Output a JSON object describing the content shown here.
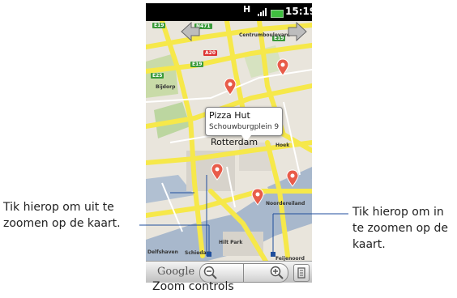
{
  "status_bar": {
    "network": "H",
    "time": "15:19"
  },
  "map": {
    "labels": [
      "Centrumboulevard",
      "Bijdorp",
      "Rotterdam",
      "Noordereiland",
      "Feijenoord",
      "Hoek",
      "Hilt Park",
      "Delfshaven",
      "Schiedam"
    ],
    "shields": [
      "N471",
      "E19",
      "E19",
      "A20",
      "E25",
      "E19"
    ]
  },
  "callout": {
    "title": "Pizza Hut",
    "address": "Schouwburgplein 9"
  },
  "city_label": "Rotterdam",
  "zoom_controls": {
    "logo": "Google",
    "zoom_out_icon": "zoom-out-icon",
    "zoom_in_icon": "zoom-in-icon",
    "menu_icon": "menu-icon"
  },
  "annotations": {
    "left_line1": "Tik hierop om uit te",
    "left_line2": "zoomen op de kaart.",
    "right_line1": "Tik hierop om in",
    "right_line2": "te zoomen op de",
    "right_line3": "kaart.",
    "bottom": "Zoom controls"
  }
}
